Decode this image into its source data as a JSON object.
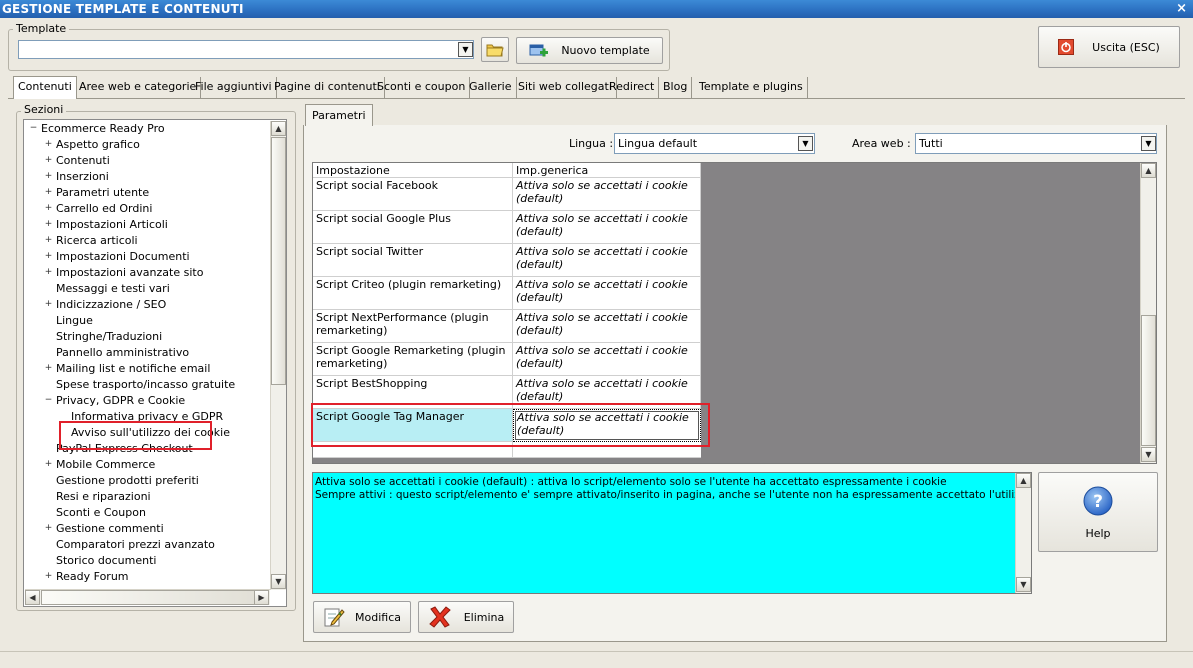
{
  "window": {
    "title": "GESTIONE TEMPLATE E CONTENUTI",
    "close_glyph": "×"
  },
  "template_group": {
    "label": "Template",
    "value": "",
    "open_icon": "folder-icon",
    "new_button": "Nuovo template",
    "new_icon": "add-window-icon"
  },
  "exit_button": {
    "label": "Uscita (ESC)",
    "icon": "power-icon"
  },
  "tabs": [
    "Contenuti",
    "Aree web e categorie",
    "File aggiuntivi",
    "Pagine di contenuti",
    "Sconti e coupon",
    "Gallerie",
    "Siti web collegati",
    "Redirect",
    "Blog",
    "Template e plugins"
  ],
  "sections": {
    "label": "Sezioni",
    "root": "Ecommerce Ready Pro",
    "items": [
      "Aspetto grafico",
      "Contenuti",
      "Inserzioni",
      "Parametri utente",
      "Carrello ed Ordini",
      "Impostazioni Articoli",
      "Ricerca articoli",
      "Impostazioni Documenti",
      "Impostazioni avanzate sito",
      "Messaggi e testi vari",
      "Indicizzazione / SEO",
      "Lingue",
      "Stringhe/Traduzioni",
      "Pannello amministrativo",
      "Mailing list e notifiche email",
      "Spese trasporto/incasso gratuite",
      "Privacy, GDPR e Cookie"
    ],
    "privacy_children": [
      "Informativa privacy e GDPR",
      "Avviso sull'utilizzo dei cookie"
    ],
    "items_after": [
      "PayPal Express Checkout",
      "Mobile Commerce",
      "Gestione prodotti preferiti",
      "Resi e riparazioni",
      "Sconti e Coupon",
      "Gestione commenti",
      "Comparatori prezzi avanzato",
      "Storico documenti",
      "Ready Forum"
    ]
  },
  "param_tab": "Parametri",
  "lingua": {
    "label": "Lingua :",
    "value": "Lingua default"
  },
  "area_web": {
    "label": "Area web :",
    "value": "Tutti"
  },
  "grid": {
    "headers": [
      "Impostazione",
      "Imp.generica"
    ],
    "rows": [
      {
        "name": "Script social Facebook",
        "value": "Attiva solo se accettati i cookie (default)"
      },
      {
        "name": "Script social Google Plus",
        "value": "Attiva solo se accettati i cookie (default)"
      },
      {
        "name": "Script social Twitter",
        "value": "Attiva solo se accettati i cookie (default)"
      },
      {
        "name": "Script Criteo (plugin remarketing)",
        "value": "Attiva solo se accettati i cookie (default)"
      },
      {
        "name": "Script NextPerformance (plugin remarketing)",
        "value": "Attiva solo se accettati i cookie (default)"
      },
      {
        "name": "Script Google Remarketing (plugin remarketing)",
        "value": "Attiva solo se accettati i cookie (default)"
      },
      {
        "name": "Script BestShopping",
        "value": "Attiva solo se accettati i cookie (default)"
      },
      {
        "name": "Script Google Tag Manager",
        "value": "Attiva solo se accettati i cookie (default)"
      }
    ]
  },
  "description": {
    "line1": "Attiva solo se accettati i cookie (default) : attiva lo script/elemento solo se l'utente ha accettato espressamente i cookie",
    "line2": "Sempre attivi : questo script/elemento e' sempre attivato/inserito in pagina, anche se l'utente non ha espressamente accettato l'utilizzo dei cookie"
  },
  "help_button": {
    "label": "Help",
    "icon": "question-icon"
  },
  "modify_button": {
    "label": "Modifica",
    "icon": "edit-icon"
  },
  "delete_button": {
    "label": "Elimina",
    "icon": "delete-x-icon"
  },
  "colors": {
    "highlight": "#e0202a",
    "selection": "#b8eef4",
    "info_bg": "#00ffff",
    "title_bar": "#2b6fc0"
  }
}
